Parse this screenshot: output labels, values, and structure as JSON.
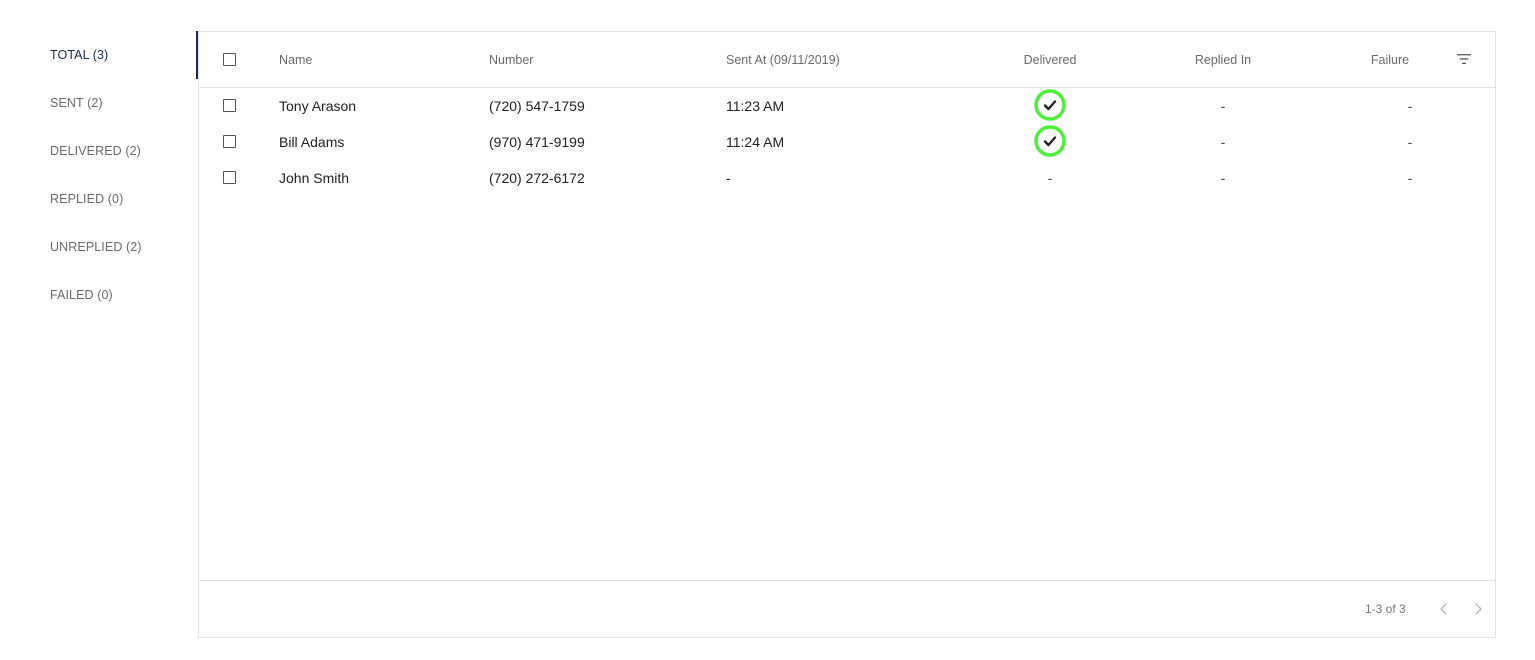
{
  "sidebar": {
    "items": [
      {
        "label": "TOTAL (3)",
        "active": true
      },
      {
        "label": "SENT (2)",
        "active": false
      },
      {
        "label": "DELIVERED (2)",
        "active": false
      },
      {
        "label": "REPLIED (0)",
        "active": false
      },
      {
        "label": "UNREPLIED (2)",
        "active": false
      },
      {
        "label": "FAILED (0)",
        "active": false
      }
    ]
  },
  "table": {
    "columns": {
      "name": "Name",
      "number": "Number",
      "sent_at": "Sent At (09/11/2019)",
      "delivered": "Delivered",
      "replied_in": "Replied In",
      "failure": "Failure"
    },
    "rows": [
      {
        "name": "Tony Arason",
        "number": "(720) 547-1759",
        "sent_at": "11:23 AM",
        "delivered": "check-icon",
        "delivered_text": "",
        "replied_in": "-",
        "failure": "-"
      },
      {
        "name": "Bill Adams",
        "number": "(970) 471-9199",
        "sent_at": "11:24 AM",
        "delivered": "check-icon",
        "delivered_text": "",
        "replied_in": "-",
        "failure": "-"
      },
      {
        "name": "John Smith",
        "number": "(720) 272-6172",
        "sent_at": "-",
        "delivered": "",
        "delivered_text": "-",
        "replied_in": "-",
        "failure": "-"
      }
    ]
  },
  "pagination": {
    "range_text": "1-3 of 3"
  },
  "icons": {
    "filter": "filter-icon",
    "prev": "chevron-left-icon",
    "next": "chevron-right-icon",
    "delivered": "check-icon"
  },
  "colors": {
    "accent": "#1b2a4a",
    "delivered_ring": "#4cf03a",
    "border": "#e2e2e2"
  }
}
